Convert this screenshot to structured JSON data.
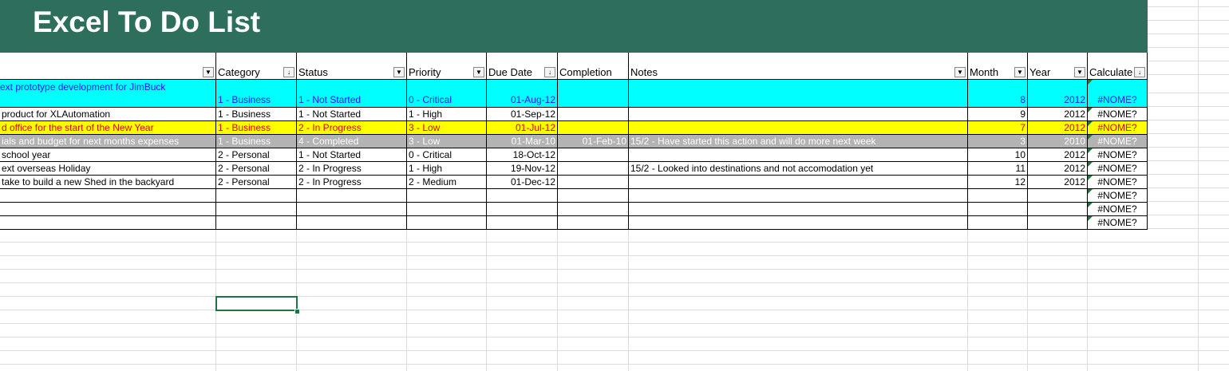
{
  "sheet": {
    "title": "Excel To Do List",
    "headers": [
      {
        "label": ""
      },
      {
        "label": "Category"
      },
      {
        "label": "Status"
      },
      {
        "label": "Priority"
      },
      {
        "label": "Due Date"
      },
      {
        "label": "Completion"
      },
      {
        "label": "Notes"
      },
      {
        "label": "Month"
      },
      {
        "label": "Year"
      },
      {
        "label": "Calculate"
      }
    ],
    "header_filter_icons": [
      "dropdown-arrow",
      "sort-arrow",
      "dropdown-arrow",
      "dropdown-arrow",
      "sort-arrow",
      "none",
      "dropdown-arrow",
      "dropdown-arrow",
      "dropdown-arrow",
      "sort-arrow"
    ],
    "rows": [
      {
        "task_line1": "ext prototype development for JimBuck",
        "task": "",
        "category": "1 - Business",
        "status": "1 - Not Started",
        "priority": "0 - Critical",
        "due": "01-Aug-12",
        "completion": "",
        "notes": "",
        "month": "8",
        "year": "2012",
        "calc": "#NOME?",
        "style": "cyan"
      },
      {
        "task": "product for XLAutomation",
        "category": "1 - Business",
        "status": "1 - Not Started",
        "priority": "1 - High",
        "due": "01-Sep-12",
        "completion": "",
        "notes": "",
        "month": "9",
        "year": "2012",
        "calc": "#NOME?",
        "style": "plain"
      },
      {
        "task": "d office for the start of the New Year",
        "category": "1 - Business",
        "status": "2 - In Progress",
        "priority": "3 - Low",
        "due": "01-Jul-12",
        "completion": "",
        "notes": "",
        "month": "7",
        "year": "2012",
        "calc": "#NOME?",
        "style": "yellow"
      },
      {
        "task": "ials and budget for next months expenses",
        "category": "1 - Business",
        "status": "4 - Completed",
        "priority": "3 - Low",
        "due": "01-Mar-10",
        "completion": "01-Feb-10",
        "notes": "15/2 - Have started this action and will do more next week",
        "month": "3",
        "year": "2010",
        "calc": "#NOME?",
        "style": "grey"
      },
      {
        "task": "school year",
        "category": "2 - Personal",
        "status": "1 - Not Started",
        "priority": "0 - Critical",
        "due": "18-Oct-12",
        "completion": "",
        "notes": "",
        "month": "10",
        "year": "2012",
        "calc": "#NOME?",
        "style": "plain"
      },
      {
        "task": "ext overseas Holiday",
        "category": "2 - Personal",
        "status": "2 - In Progress",
        "priority": "1 - High",
        "due": "19-Nov-12",
        "completion": "",
        "notes": "15/2 - Looked into destinations and not accomodation yet",
        "month": "11",
        "year": "2012",
        "calc": "#NOME?",
        "style": "plain"
      },
      {
        "task": " take to build a new Shed in the backyard",
        "category": "2 - Personal",
        "status": "2 - In Progress",
        "priority": "2 - Medium",
        "due": "01-Dec-12",
        "completion": "",
        "notes": "",
        "month": "12",
        "year": "2012",
        "calc": "#NOME?",
        "style": "plain"
      },
      {
        "task": "",
        "category": "",
        "status": "",
        "priority": "",
        "due": "",
        "completion": "",
        "notes": "",
        "month": "",
        "year": "",
        "calc": "#NOME?",
        "style": "plain"
      },
      {
        "task": "",
        "category": "",
        "status": "",
        "priority": "",
        "due": "",
        "completion": "",
        "notes": "",
        "month": "",
        "year": "",
        "calc": "#NOME?",
        "style": "plain"
      },
      {
        "task": "",
        "category": "",
        "status": "",
        "priority": "",
        "due": "",
        "completion": "",
        "notes": "",
        "month": "",
        "year": "",
        "calc": "#NOME?",
        "style": "plain"
      }
    ],
    "styles": {
      "cyan": {
        "bg": "#00ffff",
        "fg": "#1a1aff"
      },
      "yellow": {
        "bg": "#ffff00",
        "fg": "#e00000"
      },
      "grey": {
        "bg": "#b3b3b3",
        "fg": "#ffffff"
      },
      "plain": {
        "bg": "#ffffff",
        "fg": "#000000"
      }
    },
    "colors": {
      "banner": "#2e6e5c",
      "selection": "#217346",
      "error_marker": "#1a7a3a"
    }
  }
}
